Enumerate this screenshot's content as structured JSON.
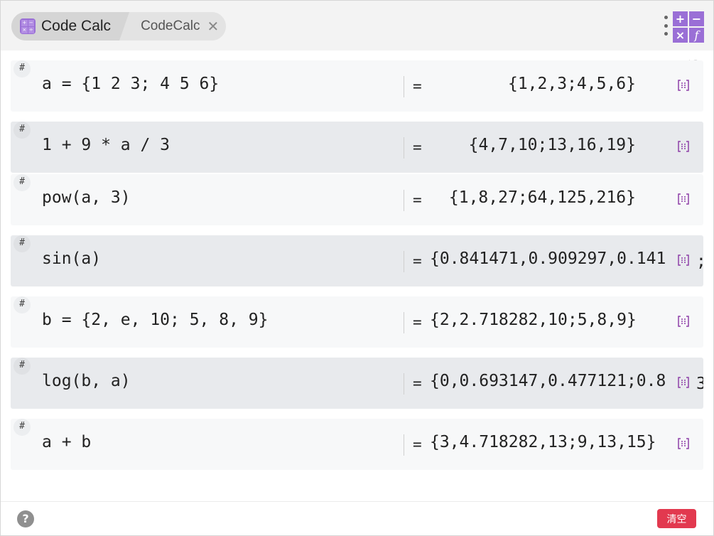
{
  "tabs": [
    {
      "label": "Code Calc",
      "active": true
    },
    {
      "label": "CodeCalc",
      "active": false
    }
  ],
  "tab_logo_glyphs": [
    "+",
    "−",
    "×",
    "÷"
  ],
  "app_logo_glyphs": [
    "+",
    "−",
    "×",
    "f"
  ],
  "accent_color": "#9a6fd6",
  "row_tag": "#",
  "equals_sign": "=",
  "rows": [
    {
      "expression": "a = {1 2 3; 4 5 6}",
      "result": "{1,2,3;4,5,6}"
    },
    {
      "expression": "1 + 9 * a / 3",
      "result": "{4,7,10;13,16,19}"
    },
    {
      "expression": "pow(a, 3)",
      "result": "{1,8,27;64,125,216}"
    },
    {
      "expression": "sin(a)",
      "result": "{0.841471,0.909297,0.141",
      "tail": ";"
    },
    {
      "expression": "b = {2, e, 10; 5, 8, 9}",
      "result": "{2,2.718282,10;5,8,9}"
    },
    {
      "expression": "log(b, a)",
      "result": "{0,0.693147,0.477121;0.8",
      "tail": "3"
    },
    {
      "expression": "a + b",
      "result": "{3,4.718282,13;9,13,15}"
    }
  ],
  "footer": {
    "help_label": "?",
    "clear_label": "清空",
    "clear_color": "#e2394f"
  }
}
